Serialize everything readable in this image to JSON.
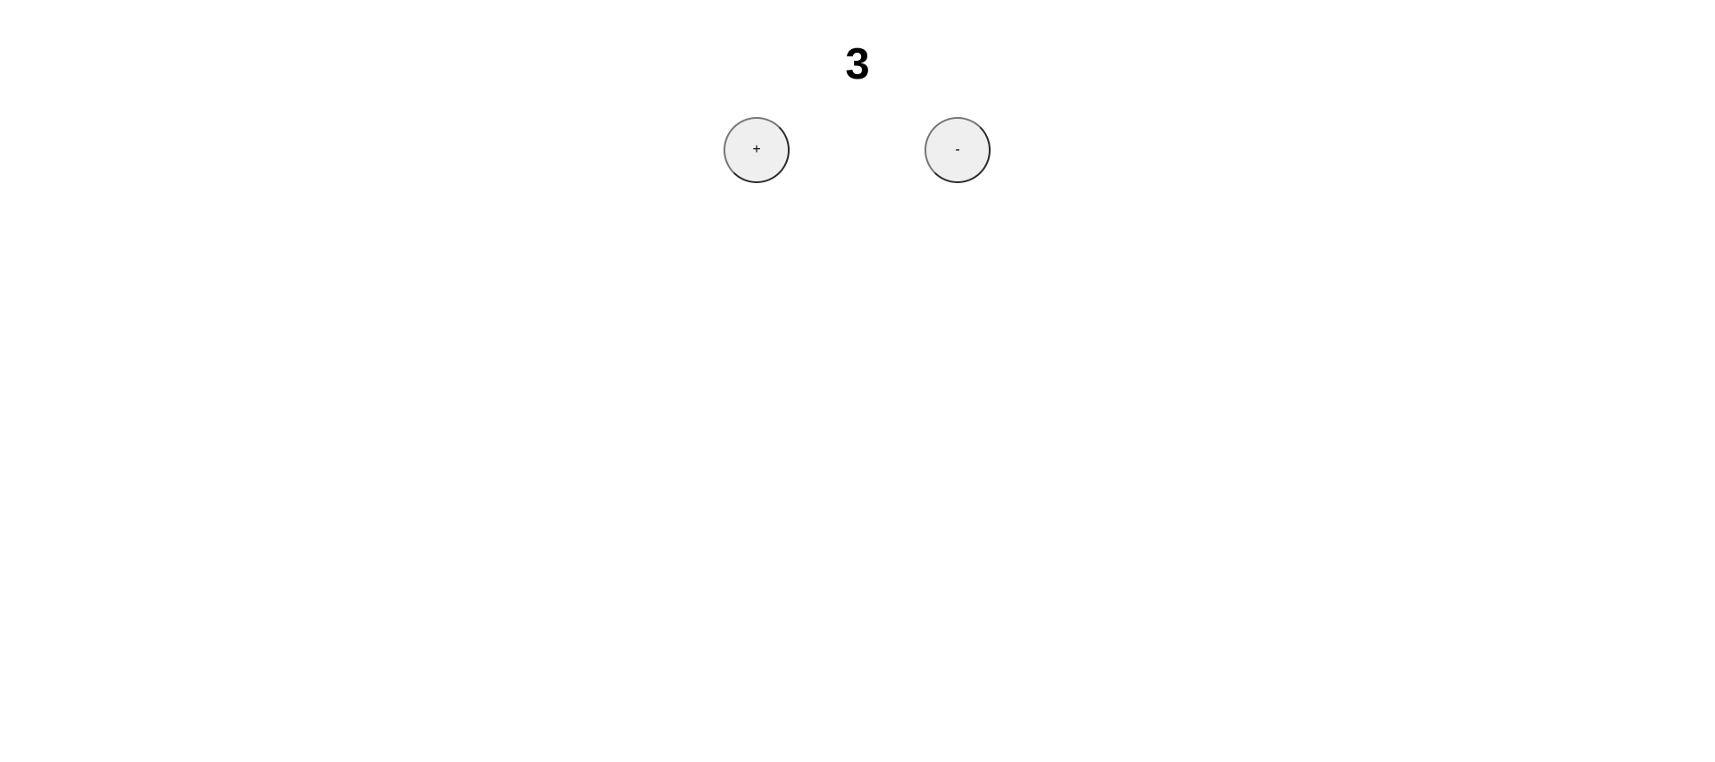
{
  "counter": {
    "value": "3"
  },
  "buttons": {
    "increment_label": "+",
    "decrement_label": "-"
  },
  "colors": {
    "background": "#ffffff",
    "button_fill": "#efefef",
    "button_border_light": "#767676",
    "button_border_dark": "#2a2a2a",
    "text": "#000000"
  }
}
